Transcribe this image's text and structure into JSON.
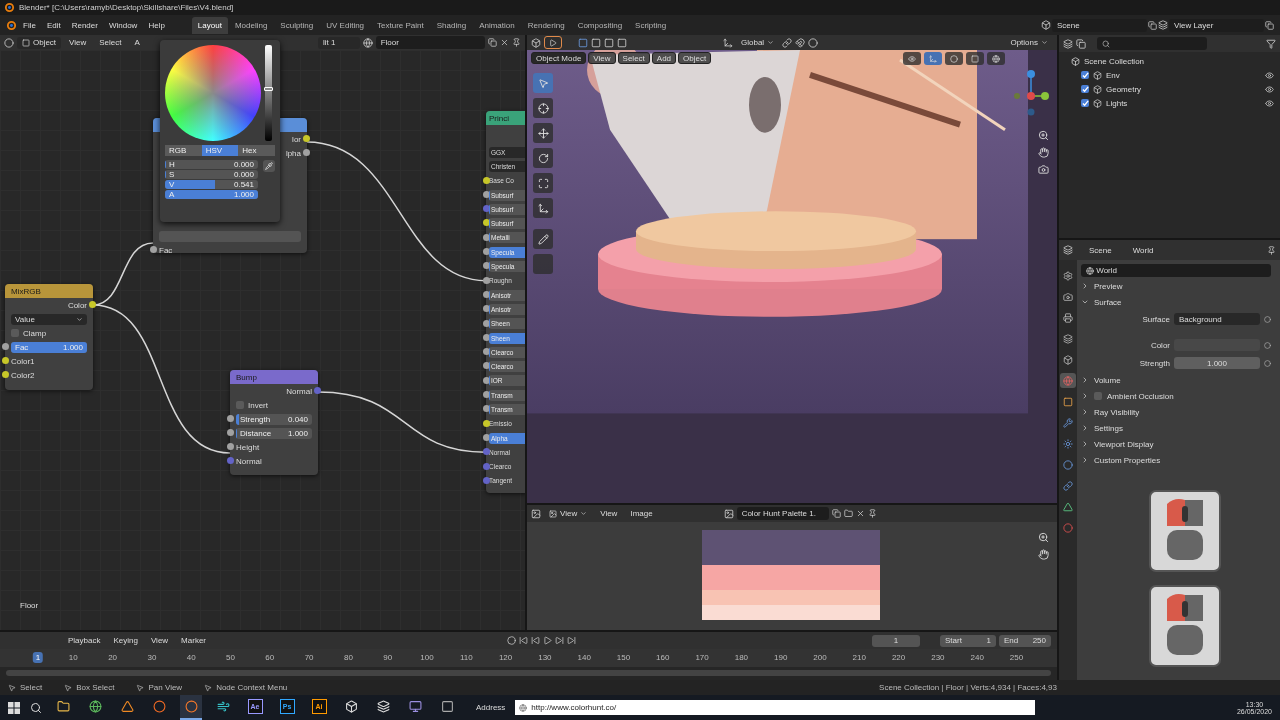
{
  "title_bar": {
    "title": "Blender* [C:\\Users\\ramyb\\Desktop\\Skillshare\\Files\\V4.blend]"
  },
  "menu_bar": {
    "menus": [
      "File",
      "Edit",
      "Render",
      "Window",
      "Help"
    ],
    "workspaces": [
      {
        "label": "Layout",
        "selected": true
      },
      {
        "label": "Modeling",
        "selected": false
      },
      {
        "label": "Sculpting",
        "selected": false
      },
      {
        "label": "UV Editing",
        "selected": false
      },
      {
        "label": "Texture Paint",
        "selected": false
      },
      {
        "label": "Shading",
        "selected": false
      },
      {
        "label": "Animation",
        "selected": false
      },
      {
        "label": "Rendering",
        "selected": false
      },
      {
        "label": "Compositing",
        "selected": false
      },
      {
        "label": "Scripting",
        "selected": false
      }
    ],
    "scene": "Scene",
    "view_layer": "View Layer"
  },
  "node_editor": {
    "header": {
      "mode": "Object",
      "menus": [
        "View",
        "Select",
        "A"
      ],
      "slot": "lit 1",
      "material": "Floor"
    },
    "color_picker": {
      "value_slider": {
        "level": 0.541
      },
      "tabs": [
        {
          "label": "RGB",
          "selected": false
        },
        {
          "label": "HSV",
          "selected": true
        },
        {
          "label": "Hex",
          "selected": false
        }
      ],
      "fields": [
        {
          "label": "H",
          "value": "0.000",
          "level": 0
        },
        {
          "label": "S",
          "value": "0.000",
          "level": 0
        },
        {
          "label": "V",
          "value": "0.541",
          "level": 0.541
        },
        {
          "label": "A",
          "value": "1.000",
          "level": 1
        }
      ]
    },
    "texture_node": {
      "outputs": [
        "lor",
        "lpha"
      ],
      "input": "Fac"
    },
    "mix_node": {
      "title": "MixRGB",
      "output": "Color",
      "blend_mode": "Value",
      "clamp": {
        "label": "Clamp",
        "checked": false
      },
      "fac": {
        "label": "Fac",
        "value": "1.000",
        "level": 1
      },
      "inputs": [
        "Color1",
        "Color2"
      ]
    },
    "bump_node": {
      "title": "Bump",
      "output": "Normal",
      "invert": {
        "label": "Invert",
        "checked": false
      },
      "fields": [
        {
          "label": "Strength",
          "value": "0.040",
          "level": 0.04
        },
        {
          "label": "Distance",
          "value": "1.000",
          "level": 0
        }
      ],
      "inputs": [
        "Height",
        "Normal"
      ]
    },
    "principled_node": {
      "title": "Princi",
      "rows": [
        {
          "label": "GGX",
          "kind": "dropdown"
        },
        {
          "label": "Christen",
          "kind": "dropdown"
        },
        {
          "label": "Base Co",
          "kind": "socket",
          "color": "#c7c729"
        },
        {
          "label": "Subsurf",
          "kind": "slider",
          "level": 0,
          "color": "#a1a1a1"
        },
        {
          "label": "Subsurf",
          "kind": "slider",
          "level": 0,
          "color": "#6363c7"
        },
        {
          "label": "Subsurf",
          "kind": "slider",
          "level": 0,
          "color": "#c7c729"
        },
        {
          "label": "Metalli",
          "kind": "slider",
          "level": 0,
          "color": "#a1a1a1"
        },
        {
          "label": "Specula",
          "kind": "slider",
          "level": 1,
          "color": "#a1a1a1"
        },
        {
          "label": "Specula",
          "kind": "slider",
          "level": 0,
          "color": "#a1a1a1"
        },
        {
          "label": "Roughn",
          "kind": "socket",
          "color": "#a1a1a1"
        },
        {
          "label": "Anisotr",
          "kind": "slider",
          "level": 0,
          "color": "#a1a1a1"
        },
        {
          "label": "Anisotr",
          "kind": "slider",
          "level": 0,
          "color": "#a1a1a1"
        },
        {
          "label": "Sheen",
          "kind": "slider",
          "level": 0,
          "color": "#a1a1a1"
        },
        {
          "label": "Sheen",
          "kind": "slider",
          "level": 1,
          "color": "#a1a1a1"
        },
        {
          "label": "Clearco",
          "kind": "slider",
          "level": 0,
          "color": "#a1a1a1"
        },
        {
          "label": "Clearco",
          "kind": "slider",
          "level": 0,
          "color": "#a1a1a1"
        },
        {
          "label": "IOR",
          "kind": "slider",
          "level": 0,
          "color": "#a1a1a1"
        },
        {
          "label": "Transm",
          "kind": "slider",
          "level": 0,
          "color": "#a1a1a1"
        },
        {
          "label": "Transm",
          "kind": "slider",
          "level": 0,
          "color": "#a1a1a1"
        },
        {
          "label": "Emissio",
          "kind": "socket",
          "color": "#c7c729"
        },
        {
          "label": "Alpha",
          "kind": "slider",
          "level": 1,
          "color": "#a1a1a1"
        },
        {
          "label": "Normal",
          "kind": "socket",
          "color": "#6363c7"
        },
        {
          "label": "Clearco",
          "kind": "socket",
          "color": "#6363c7"
        },
        {
          "label": "Tangent",
          "kind": "socket",
          "color": "#6363c7"
        }
      ]
    },
    "footer_label": "Floor"
  },
  "viewport": {
    "header": {
      "orientation": "Global",
      "options": "Options"
    },
    "overlay_header": {
      "mode": "Object Mode",
      "menus": [
        "View",
        "Select",
        "Add",
        "Object"
      ]
    },
    "tools": [
      {
        "kind": "select",
        "selected": true
      },
      {
        "kind": "cursor",
        "selected": false
      },
      {
        "kind": "move",
        "selected": false
      },
      {
        "kind": "rotate",
        "selected": false
      },
      {
        "kind": "scale",
        "selected": false
      },
      {
        "kind": "transform",
        "selected": false
      },
      {
        "kind": "annotate",
        "selected": false
      },
      {
        "kind": "measure",
        "selected": false
      }
    ]
  },
  "image_editor": {
    "header": {
      "mode": "View",
      "menus": [
        "View",
        "Image"
      ],
      "image": "Color Hunt Palette 1."
    },
    "palette": [
      {
        "color": "#5e5273"
      },
      {
        "color": "#f6a6a4"
      },
      {
        "color": "#f8c3b3"
      },
      {
        "color": "#fadcd3"
      }
    ]
  },
  "outliner": {
    "root": "Scene Collection",
    "children": [
      {
        "label": "Env",
        "checked": true
      },
      {
        "label": "Geometry",
        "checked": true
      },
      {
        "label": "Lights",
        "checked": true
      }
    ]
  },
  "properties": {
    "crumbs": [
      "Scene",
      "World"
    ],
    "datablock": "World",
    "tabs": [
      {
        "kind": "tool",
        "selected": false
      },
      {
        "kind": "render",
        "selected": false
      },
      {
        "kind": "output",
        "selected": false
      },
      {
        "kind": "view_layer",
        "selected": false
      },
      {
        "kind": "scene",
        "selected": false
      },
      {
        "kind": "world",
        "selected": true
      },
      {
        "kind": "object",
        "selected": false
      },
      {
        "kind": "modifier",
        "selected": false
      },
      {
        "kind": "particles",
        "selected": false
      },
      {
        "kind": "physics",
        "selected": false
      },
      {
        "kind": "constraint",
        "selected": false
      },
      {
        "kind": "data",
        "selected": false
      },
      {
        "kind": "material",
        "selected": false
      }
    ],
    "panels": [
      {
        "label": "Preview",
        "expanded": false
      },
      {
        "label": "Surface",
        "expanded": true,
        "fields": [
          {
            "label": "Surface",
            "kind": "dropdown",
            "value": "Background"
          },
          {
            "label": "Color",
            "kind": "color"
          },
          {
            "label": "Strength",
            "kind": "number",
            "value": "1.000"
          }
        ]
      },
      {
        "label": "Volume",
        "expanded": false
      },
      {
        "label": "Ambient Occlusion",
        "expanded": false,
        "checked": false
      },
      {
        "label": "Ray Visibility",
        "expanded": false
      },
      {
        "label": "Settings",
        "expanded": false
      },
      {
        "label": "Viewport Display",
        "expanded": false
      },
      {
        "label": "Custom Properties",
        "expanded": false
      }
    ]
  },
  "timeline": {
    "menus": [
      "Playback",
      "Keying",
      "View",
      "Marker"
    ],
    "current_frame": "1",
    "start_label": "Start",
    "start": "1",
    "end_label": "End",
    "end": "250",
    "ruler": [
      {
        "label": "1",
        "selected": true
      },
      {
        "label": "10",
        "selected": false
      },
      {
        "label": "20",
        "selected": false
      },
      {
        "label": "30",
        "selected": false
      },
      {
        "label": "40",
        "selected": false
      },
      {
        "label": "50",
        "selected": false
      },
      {
        "label": "60",
        "selected": false
      },
      {
        "label": "70",
        "selected": false
      },
      {
        "label": "80",
        "selected": false
      },
      {
        "label": "90",
        "selected": false
      },
      {
        "label": "100",
        "selected": false
      },
      {
        "label": "110",
        "selected": false
      },
      {
        "label": "120",
        "selected": false
      },
      {
        "label": "130",
        "selected": false
      },
      {
        "label": "140",
        "selected": false
      },
      {
        "label": "150",
        "selected": false
      },
      {
        "label": "160",
        "selected": false
      },
      {
        "label": "170",
        "selected": false
      },
      {
        "label": "180",
        "selected": false
      },
      {
        "label": "190",
        "selected": false
      },
      {
        "label": "200",
        "selected": false
      },
      {
        "label": "210",
        "selected": false
      },
      {
        "label": "220",
        "selected": false
      },
      {
        "label": "230",
        "selected": false
      },
      {
        "label": "240",
        "selected": false
      },
      {
        "label": "250",
        "selected": false
      }
    ]
  },
  "status_bar": {
    "hints": [
      "Select",
      "Box Select",
      "Pan View",
      "Node Context Menu"
    ],
    "stats": "Scene Collection | Floor | Verts:4,934 | Faces:4,93"
  },
  "taskbar": {
    "apps": [
      {
        "kind": "folder",
        "active": false
      },
      {
        "kind": "browser",
        "active": false
      },
      {
        "kind": "cone",
        "active": false
      },
      {
        "kind": "spiral",
        "active": false
      },
      {
        "kind": "blender",
        "active": true
      },
      {
        "kind": "wave",
        "active": false
      },
      {
        "kind": "badge",
        "label": "Ae",
        "color": "#9999ff"
      },
      {
        "kind": "badge",
        "label": "Ps",
        "color": "#31a8ff"
      },
      {
        "kind": "badge",
        "label": "Ai",
        "color": "#ff9a00"
      },
      {
        "kind": "cube",
        "active": false
      },
      {
        "kind": "stack",
        "active": false
      },
      {
        "kind": "panel",
        "active": false
      },
      {
        "kind": "square",
        "active": false
      }
    ],
    "address_label": "Address",
    "url": "http://www.colorhunt.co/",
    "time": "13:30",
    "date": "26/05/2020"
  }
}
